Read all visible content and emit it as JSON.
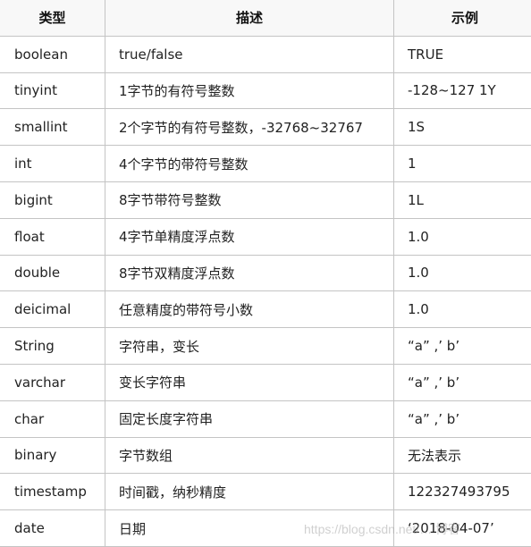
{
  "table": {
    "headers": [
      "类型",
      "描述",
      "示例"
    ],
    "rows": [
      {
        "type": "boolean",
        "desc": "true/false",
        "example": "TRUE"
      },
      {
        "type": "tinyint",
        "desc": "1字节的有符号整数",
        "example": "-128~127 1Y"
      },
      {
        "type": "smallint",
        "desc": "2个字节的有符号整数，-32768~32767",
        "example": "1S"
      },
      {
        "type": "int",
        "desc": "4个字节的带符号整数",
        "example": "1"
      },
      {
        "type": "bigint",
        "desc": "8字节带符号整数",
        "example": "1L"
      },
      {
        "type": "float",
        "desc": "4字节单精度浮点数",
        "example": "1.0"
      },
      {
        "type": "double",
        "desc": "8字节双精度浮点数",
        "example": "1.0"
      },
      {
        "type": "deicimal",
        "desc": "任意精度的带符号小数",
        "example": "1.0"
      },
      {
        "type": "String",
        "desc": "字符串，变长",
        "example": " “a” ,’ b’"
      },
      {
        "type": "varchar",
        "desc": "变长字符串",
        "example": " “a” ,’ b’"
      },
      {
        "type": "char",
        "desc": "固定长度字符串",
        "example": " “a” ,’ b’"
      },
      {
        "type": "binary",
        "desc": "字节数组",
        "example": "无法表示"
      },
      {
        "type": "timestamp",
        "desc": "时间戳，纳秒精度",
        "example": "122327493795"
      },
      {
        "type": "date",
        "desc": "日期",
        "example": "‘2018-04-07’"
      }
    ]
  },
  "watermark": "https://blog.csdn.net/… 博客"
}
